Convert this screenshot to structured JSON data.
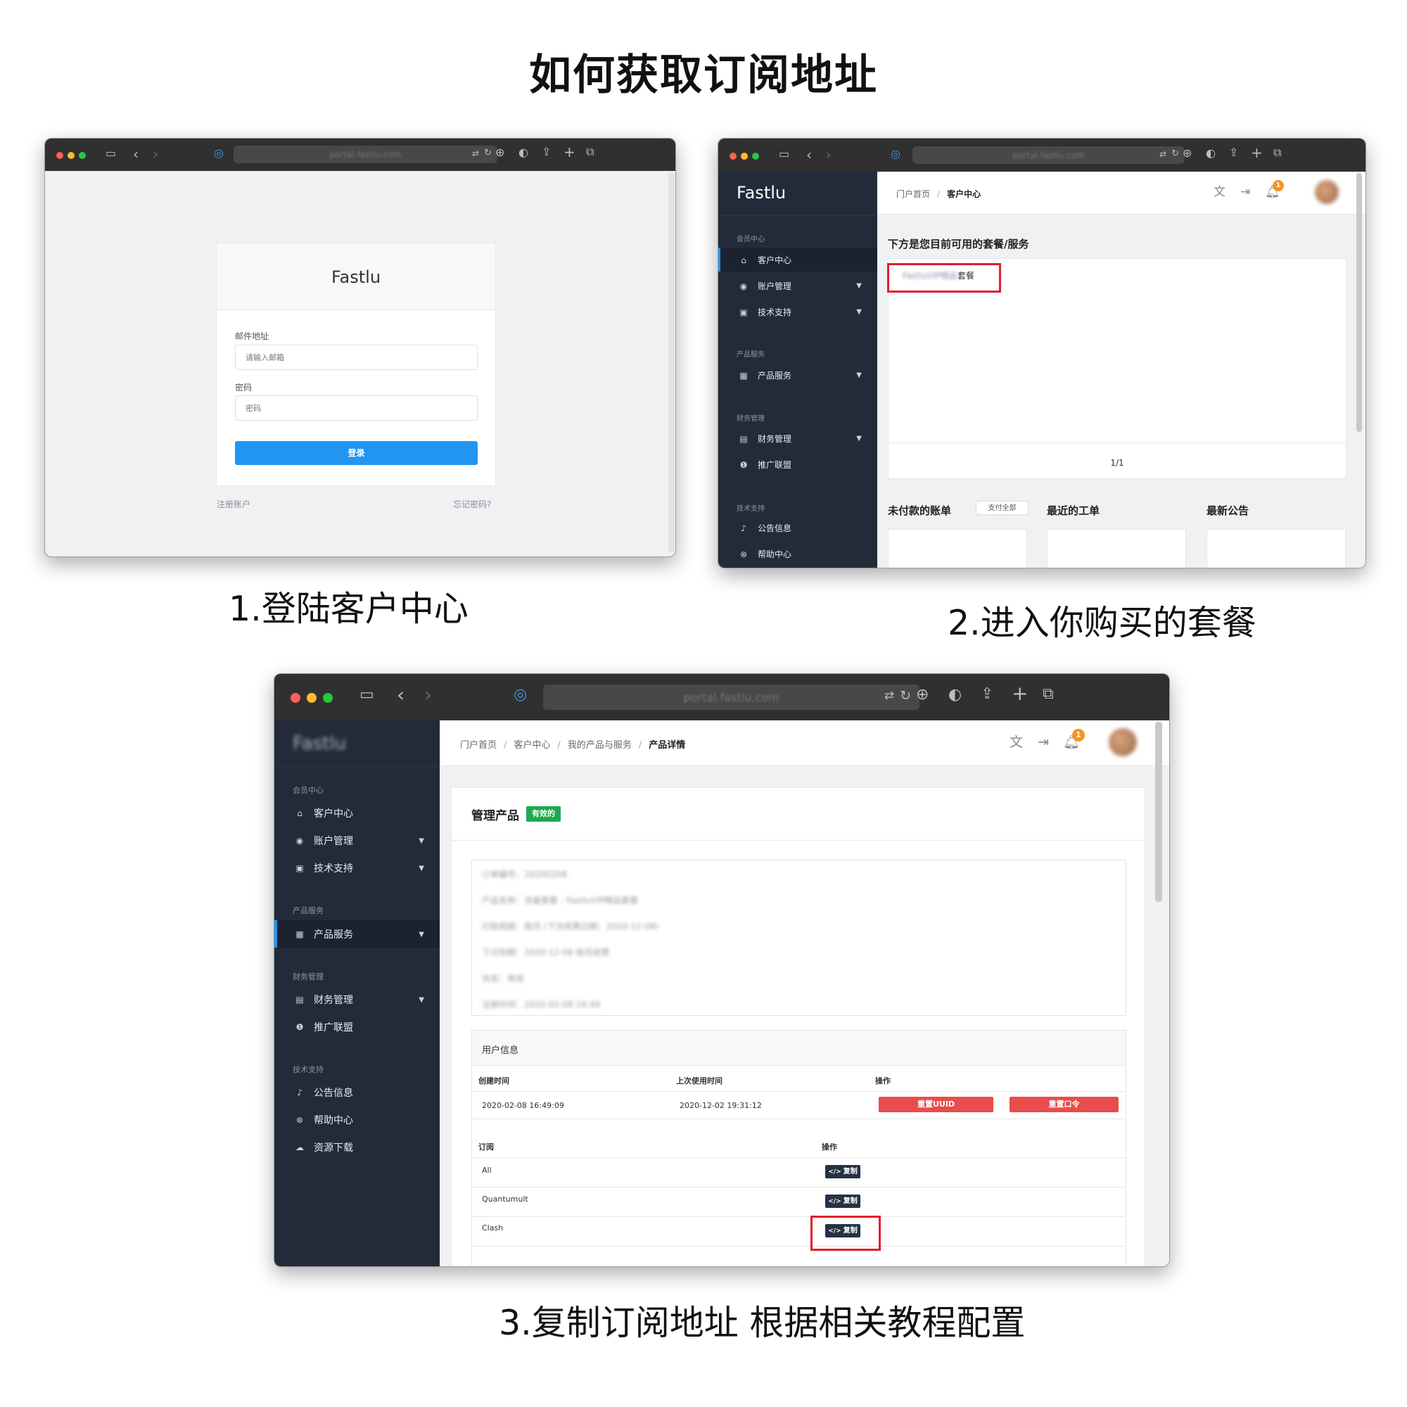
{
  "page_title": "如何获取订阅地址",
  "captions": {
    "step1": "1.登陆客户中心",
    "step2": "2.进入你购买的套餐",
    "step3": "3.复制订阅地址 根据相关教程配置"
  },
  "browser": {
    "url": "portal.fastlu.com"
  },
  "login": {
    "brand": "Fastlu",
    "email_label": "邮件地址",
    "email_placeholder": "请输入邮箱",
    "password_label": "密码",
    "password_placeholder": "密码",
    "submit": "登录",
    "register_link": "注册账户",
    "forgot_link": "忘记密码?"
  },
  "sidebar": {
    "brand": "Fastlu",
    "sections": {
      "member": "会员中心",
      "products": "产品服务",
      "finance": "财务管理",
      "support": "技术支持"
    },
    "items": {
      "client_center": "客户中心",
      "account": "账户管理",
      "tech_support": "技术支持",
      "products": "产品服务",
      "finance": "财务管理",
      "affiliate": "推广联盟",
      "announcements": "公告信息",
      "help": "帮助中心",
      "downloads": "资源下载"
    }
  },
  "dashboard": {
    "breadcrumb": [
      "门户首页",
      "客户中心"
    ],
    "notification_count": "1",
    "services_heading": "下方是您目前可用的套餐/服务",
    "service_item_blurred": "FastluVIP精品",
    "service_item_suffix": "套餐",
    "pagination": "1/1",
    "unpaid_title": "未付款的账单",
    "pay_all": "支付全部",
    "tickets_title": "最近的工单",
    "news_title": "最新公告"
  },
  "product": {
    "breadcrumb": [
      "门户首页",
      "客户中心",
      "我的产品与服务",
      "产品详情"
    ],
    "manage_title": "管理产品",
    "status": "有效的",
    "details_blurred": [
      "订单编号：20200208",
      "产品名称：流量套餐 - FastluVIP精品套餐",
      "付款周期：按月 (下次续费日期：2020-12-08)",
      "下次到期：2020-12-08 按月续费",
      "状态：有效",
      "注册时间：2020-02-08 16:49"
    ],
    "user_info_title": "用户信息",
    "columns": {
      "created": "创建时间",
      "last_used": "上次使用时间",
      "action": "操作"
    },
    "created": "2020-02-08 16:49:09",
    "last_used": "2020-12-02 19:31:12",
    "reset_uuid": "重置UUID",
    "reset_password": "重置口令",
    "sub_columns": {
      "subscription": "订阅",
      "action": "操作"
    },
    "subscriptions": [
      {
        "name": "All",
        "action": "复制"
      },
      {
        "name": "Quantumult",
        "action": "复制"
      },
      {
        "name": "Clash",
        "action": "复制"
      }
    ]
  },
  "colors": {
    "accent_blue": "#2196f3",
    "sidebar_bg": "#232b3a",
    "highlight_red": "#e21d2a",
    "status_green": "#1ea94f",
    "danger": "#e84c4c"
  }
}
